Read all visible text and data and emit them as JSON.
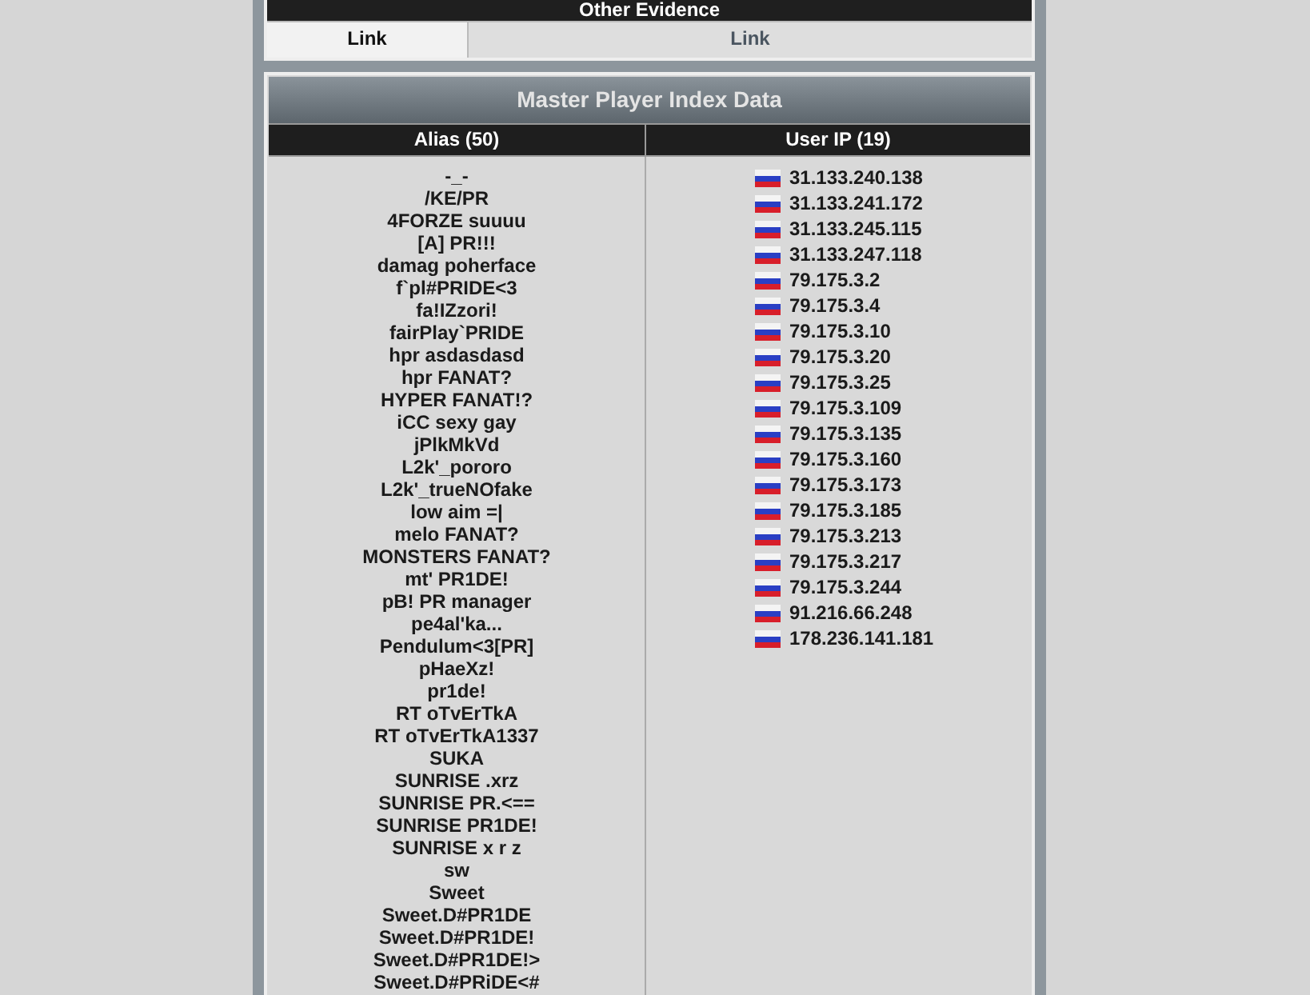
{
  "other_evidence": {
    "title": "Other Evidence",
    "links": [
      {
        "label": "Link",
        "selected": true
      },
      {
        "label": "Link",
        "selected": false
      }
    ]
  },
  "master_player_index": {
    "title": "Master Player Index Data",
    "columns": [
      "Alias (50)",
      "User IP (19)"
    ],
    "aliases": [
      "-_-",
      "/KE/PR",
      "4FORZE suuuu",
      "[A] PR!!!",
      "damag poherface",
      "f`pl#PRIDE<3",
      "fa!IZzori!",
      "fairPlay`PRIDE",
      "hpr asdasdasd",
      "hpr FANAT?",
      "HYPER FANAT!?",
      "iCC sexy gay",
      "jPlkMkVd",
      "L2k'_pororo",
      "L2k'_trueNOfake",
      "low aim =|",
      "melo FANAT?",
      "MONSTERS FANAT?",
      "mt' PR1DE!",
      "pB! PR manager",
      "pe4al'ka...",
      "Pendulum<3[PR]",
      "pHaeXz!",
      "pr1de!",
      "RT oTvErTkA",
      "RT oTvErTkA1337",
      "SUKA",
      "SUNRISE .xrz",
      "SUNRISE PR.<==",
      "SUNRISE PR1DE!",
      "SUNRISE x r z",
      "sw",
      "Sweet",
      "Sweet.D#PR1DE",
      "Sweet.D#PR1DE!",
      "Sweet.D#PR1DE!>",
      "Sweet.D#PRiDE<#"
    ],
    "ips": [
      "31.133.240.138",
      "31.133.241.172",
      "31.133.245.115",
      "31.133.247.118",
      "79.175.3.2",
      "79.175.3.4",
      "79.175.3.10",
      "79.175.3.20",
      "79.175.3.25",
      "79.175.3.109",
      "79.175.3.135",
      "79.175.3.160",
      "79.175.3.173",
      "79.175.3.185",
      "79.175.3.213",
      "79.175.3.217",
      "79.175.3.244",
      "91.216.66.248",
      "178.236.141.181"
    ]
  }
}
